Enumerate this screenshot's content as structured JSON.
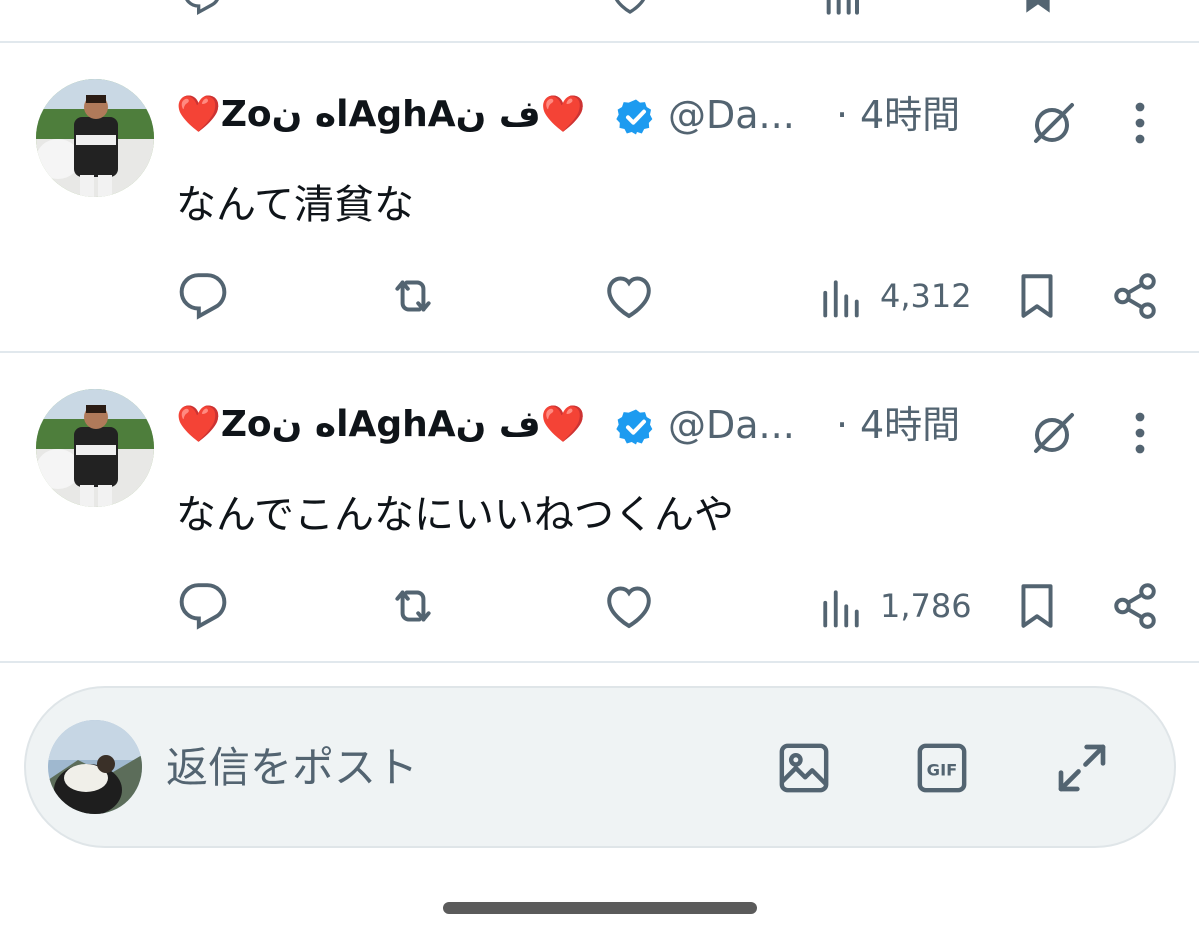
{
  "colors": {
    "text_primary": "#0f1419",
    "text_secondary": "#536471",
    "verified_blue": "#1d9bf0",
    "heart_red": "#e0245e",
    "divider": "#e1e8ed",
    "reply_bar_bg": "#eff3f4"
  },
  "tweets": [
    {
      "author": {
        "heart_left": "❤️",
        "name_text": "Zoاه نAghAف ن",
        "heart_right": "❤️",
        "verified_icon": "verified-badge-icon",
        "handle": "@Da...",
        "avatar_icon": "profile-avatar"
      },
      "separator": "·",
      "time": "4時間",
      "text": "なんて清貧な",
      "actions": {
        "reply_icon": "reply-icon",
        "retweet_icon": "retweet-icon",
        "like_icon": "like-icon",
        "views_icon": "views-icon",
        "views_count": "4,312",
        "bookmark_icon": "bookmark-icon",
        "share_icon": "share-icon"
      }
    },
    {
      "author": {
        "heart_left": "❤️",
        "name_text": "Zoاه نAghAف ن",
        "heart_right": "❤️",
        "verified_icon": "verified-badge-icon",
        "handle": "@Da...",
        "avatar_icon": "profile-avatar"
      },
      "separator": "·",
      "time": "4時間",
      "text": "なんでこんなにいいねつくんや",
      "actions": {
        "reply_icon": "reply-icon",
        "retweet_icon": "retweet-icon",
        "like_icon": "like-icon",
        "views_icon": "views-icon",
        "views_count": "1,786",
        "bookmark_icon": "bookmark-icon",
        "share_icon": "share-icon"
      }
    }
  ],
  "reply_bar": {
    "placeholder": "返信をポスト",
    "image_icon": "image-icon",
    "gif_label": "GIF",
    "expand_icon": "expand-icon"
  }
}
